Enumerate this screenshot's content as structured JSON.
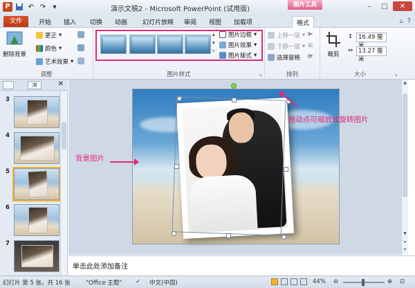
{
  "titlebar": {
    "title": "演示文稿2 - Microsoft PowerPoint (试用版)",
    "context_tab_title": "图片工具",
    "app_icon": "P"
  },
  "tabs": {
    "file": "文件",
    "items": [
      "开始",
      "插入",
      "切换",
      "动画",
      "幻灯片放映",
      "审阅",
      "视图",
      "加载项",
      "格式"
    ],
    "active": "格式"
  },
  "ribbon": {
    "adjust": {
      "remove_bg": "删除背景",
      "correct": "更正",
      "color": "颜色",
      "art_effects": "艺术效果",
      "group_label": "调整"
    },
    "picture_styles": {
      "border": "图片边框",
      "effects": "图片效果",
      "layout": "图片版式",
      "group_label": "图片样式"
    },
    "arrange": {
      "bring_forward": "上移一层",
      "send_backward": "下移一层",
      "selection_pane": "选择窗格",
      "group_label": "排列"
    },
    "size": {
      "crop": "裁剪",
      "height": "16.49 厘米",
      "width": "13.27 厘米",
      "group_label": "大小"
    }
  },
  "slides_panel": {
    "tab_label": "浏",
    "slides": [
      {
        "num": "3",
        "selected": false
      },
      {
        "num": "4",
        "selected": false
      },
      {
        "num": "5",
        "selected": true
      },
      {
        "num": "6",
        "selected": false
      },
      {
        "num": "7",
        "selected": false
      }
    ]
  },
  "canvas": {
    "bg_callout": "背景图片",
    "handle_callout": "拖动点可缩放或旋转图片"
  },
  "notes": {
    "placeholder": "单击此处添加备注"
  },
  "statusbar": {
    "slide_info": "幻灯片 第 5 张，共 16 张",
    "theme": "\"Office 主题\"",
    "language": "中文(中国)",
    "zoom": "44%"
  },
  "colors": {
    "accent": "#e3287a",
    "file_tab": "#c8461f",
    "context_tab": "#e35c8a"
  }
}
